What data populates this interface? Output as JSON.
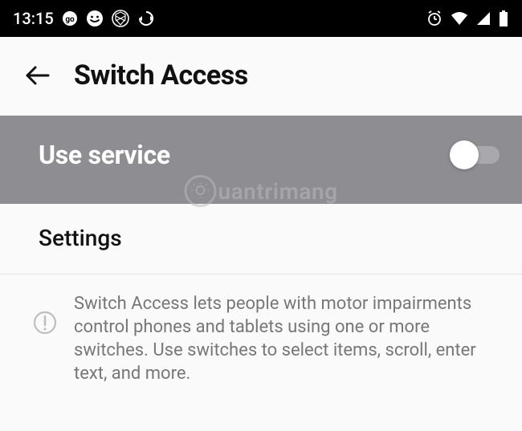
{
  "status_bar": {
    "time": "13:15"
  },
  "header": {
    "title": "Switch Access"
  },
  "service": {
    "label": "Use service",
    "enabled": false
  },
  "watermark": {
    "text": "uantrimang"
  },
  "settings": {
    "label": "Settings"
  },
  "info": {
    "text": "Switch Access lets people with motor impairments control phones and tablets using one or more switches. Use switches to select items, scroll, enter text, and more."
  }
}
